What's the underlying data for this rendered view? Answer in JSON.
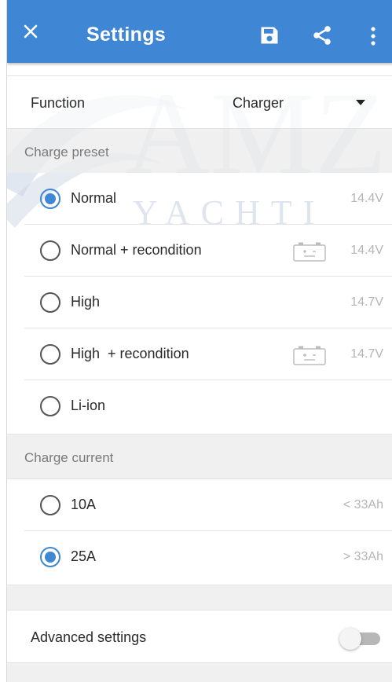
{
  "header": {
    "title": "Settings",
    "background": "#3f86d4",
    "icons": [
      "close-icon",
      "save-icon",
      "share-icon",
      "more-vert-icon"
    ]
  },
  "watermark": {
    "big": "AMZ",
    "small": "YACHTI"
  },
  "function": {
    "label": "Function",
    "value": "Charger"
  },
  "charge_preset": {
    "title": "Charge preset",
    "options": [
      {
        "name": "Normal",
        "value": "14.4V",
        "checked": true,
        "recondition_icon": false
      },
      {
        "name": "Normal + recondition",
        "value": "14.4V",
        "checked": false,
        "recondition_icon": true
      },
      {
        "name": "High",
        "value": "14.7V",
        "checked": false,
        "recondition_icon": false
      },
      {
        "name": "High  + recondition",
        "value": "14.7V",
        "checked": false,
        "recondition_icon": true
      },
      {
        "name": "Li-ion",
        "value": "",
        "checked": false,
        "recondition_icon": false
      }
    ]
  },
  "charge_current": {
    "title": "Charge current",
    "options": [
      {
        "name": "10A",
        "value": "< 33Ah",
        "checked": false
      },
      {
        "name": "25A",
        "value": "> 33Ah",
        "checked": true
      }
    ]
  },
  "advanced": {
    "label": "Advanced settings",
    "enabled": false
  },
  "colors": {
    "accent": "#3f86d4",
    "muted_text": "#b5b5b5",
    "section_bg": "#ececec"
  }
}
